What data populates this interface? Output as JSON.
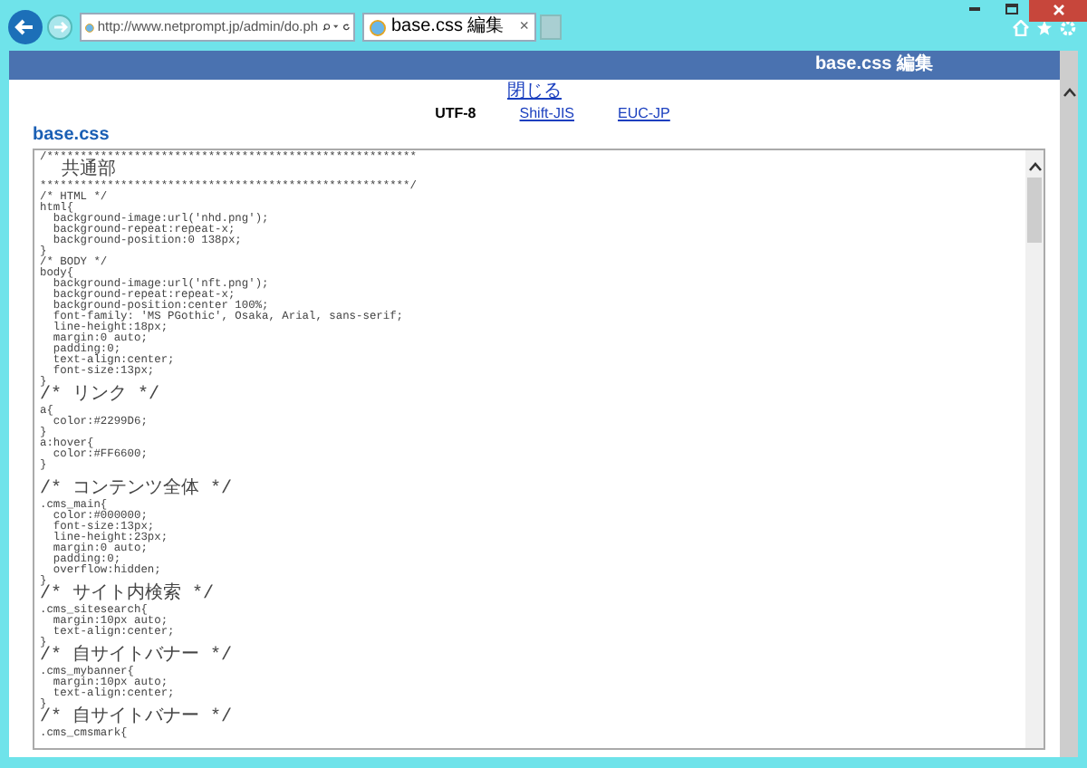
{
  "browser": {
    "address": "http://www.netprompt.jp/admin/do.ph",
    "tab_title": "base.css 編集",
    "tab_close": "×"
  },
  "page": {
    "header_title": "base.css 編集",
    "close_link": "閉じる",
    "encodings": [
      {
        "label": "UTF-8",
        "selected": true
      },
      {
        "label": "Shift-JIS",
        "selected": false
      },
      {
        "label": "EUC-JP",
        "selected": false
      }
    ],
    "file_title": "base.css",
    "code_blocks": [
      [
        "/*******************************************************",
        "  共通部",
        "*******************************************************/",
        "/* HTML */",
        "html{",
        "  background-image:url('nhd.png');",
        "  background-repeat:repeat-x;",
        "  background-position:0 138px;",
        "}",
        "/* BODY */",
        "body{",
        "  background-image:url('nft.png');",
        "  background-repeat:repeat-x;",
        "  background-position:center 100%;",
        "  font-family: 'MS PGothic', Osaka, Arial, sans-serif;",
        "  line-height:18px;",
        "  margin:0 auto;",
        "  padding:0;",
        "  text-align:center;",
        "  font-size:13px;",
        "}",
        "/* リンク */",
        "a{",
        "  color:#2299D6;",
        "}",
        "a:hover{",
        "  color:#FF6600;",
        "}"
      ],
      [
        "/* コンテンツ全体 */",
        ".cms_main{",
        "  color:#000000;",
        "  font-size:13px;",
        "  line-height:23px;",
        "  margin:0 auto;",
        "  padding:0;",
        "  overflow:hidden;",
        "}",
        "/* サイト内検索 */",
        ".cms_sitesearch{",
        "  margin:10px auto;",
        "  text-align:center;",
        "}",
        "/* 自サイトバナー */",
        ".cms_mybanner{",
        "  margin:10px auto;",
        "  text-align:center;",
        "}",
        "/* 自サイトバナー */",
        ".cms_cmsmark{"
      ]
    ]
  }
}
